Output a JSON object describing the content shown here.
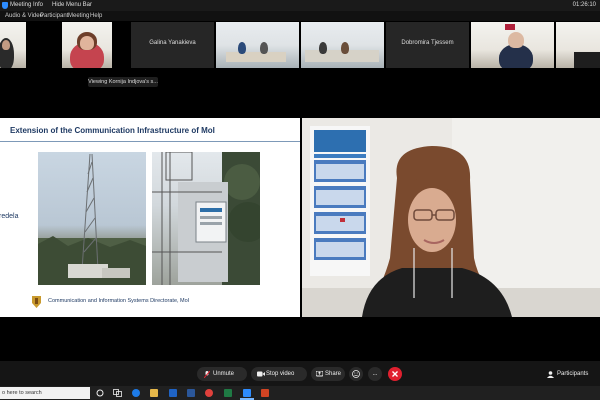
{
  "titlebar": {
    "meeting_info": "Meeting Info",
    "hide_menu_bar": "Hide Menu Bar",
    "clock": "01:26:10"
  },
  "menu": {
    "items": [
      "Audio & Video",
      "Participant",
      "Meeting",
      "Help"
    ]
  },
  "participants": {
    "names": [
      "Galina Yanakieva",
      "Dobromira Tjessem"
    ]
  },
  "viewing_label": "Viewing Kornija Indjova's s...",
  "slide": {
    "title": "Extension of the Communication Infrastructure of MoI",
    "side_text": "redela",
    "footer": "Communication and Information Systems Directorate, MoI"
  },
  "toolbar": {
    "unmute": "Unmute",
    "stop_video": "Stop video",
    "share": "Share",
    "more": "...",
    "participants": "Participants"
  },
  "taskbar": {
    "search_text": "o here to search"
  },
  "colors": {
    "end_meeting": "#e0202f",
    "slide_title": "#1f3a63",
    "zoom_blue": "#2d8cff"
  }
}
